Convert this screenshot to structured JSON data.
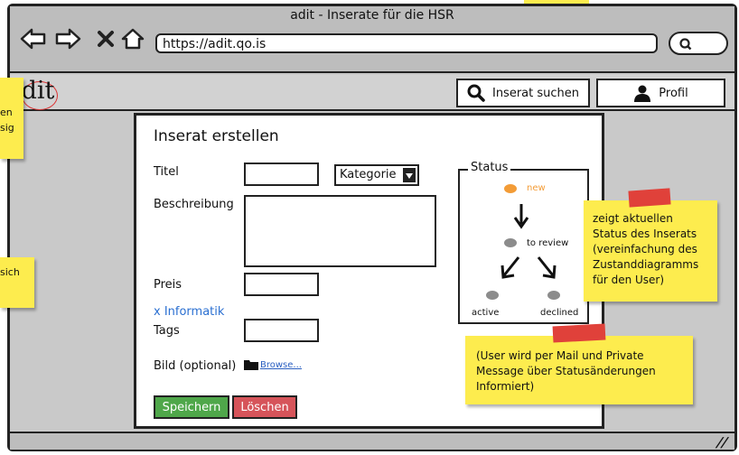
{
  "window": {
    "title": "adit - Inserate für die HSR"
  },
  "browser": {
    "url": "https://adit.qo.is"
  },
  "app": {
    "logo_text": "dit",
    "search_button_label": "Inserat suchen",
    "profile_button_label": "Profil"
  },
  "form": {
    "heading": "Inserat erstellen",
    "title_label": "Titel",
    "category_select_value": "Kategorie",
    "description_label": "Beschreibung",
    "price_label": "Preis",
    "tag_item": "x Informatik",
    "tags_label": "Tags",
    "image_label": "Bild (optional)",
    "browse_link": "Browse...",
    "save_button": "Speichern",
    "delete_button": "Löschen"
  },
  "status_panel": {
    "legend": "Status",
    "states": {
      "new": "new",
      "review": "to review",
      "active": "active",
      "declined": "declined"
    }
  },
  "notes": {
    "left_1": [
      "en",
      "sig"
    ],
    "left_2": [
      "sich"
    ],
    "status_note": [
      "zeigt aktuellen",
      "Status des Inserats",
      "(vereinfachung des",
      "Zustanddiagramms",
      "für den User)"
    ],
    "mail_note": [
      "(User wird per Mail und Private",
      "Message über Statusänderungen",
      "Informiert)"
    ]
  },
  "colors": {
    "state_new": "#f39c37",
    "state_other": "#8c8c8c",
    "save": "#4fa74a",
    "delete": "#d6545a",
    "link": "#2a6fd1",
    "sticky": "#fdec4e",
    "tape": "#e0413a"
  }
}
